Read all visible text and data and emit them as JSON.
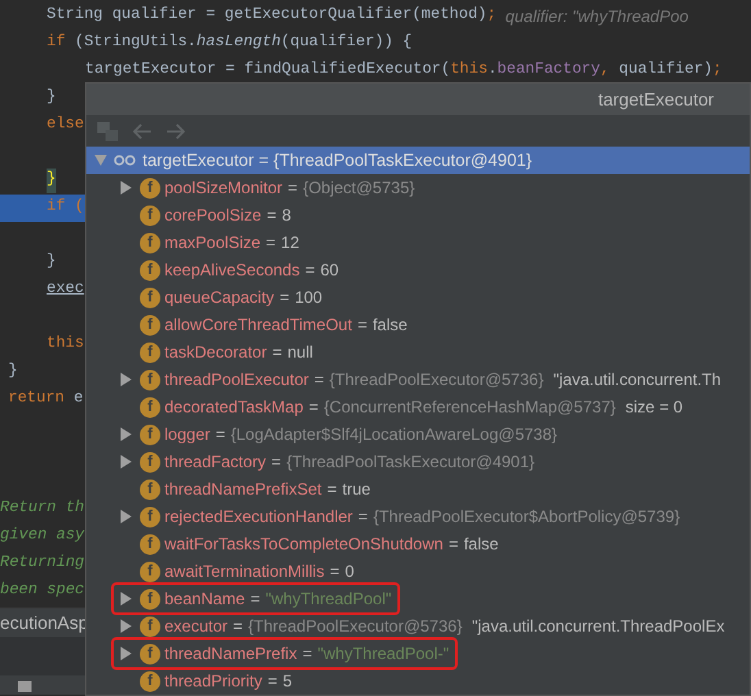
{
  "editor": {
    "lines": [
      {
        "kind": "method",
        "segments": [
          {
            "text": "String qualifier = getExecutorQualifier(method)",
            "kind": "plain"
          },
          {
            "text": ";",
            "kind": "keyword"
          },
          {
            "text": "  qualifier: \"whyThreadPoo",
            "kind": "hint"
          }
        ]
      },
      {
        "kind": "method",
        "segments": [
          {
            "text": "if ",
            "kind": "keyword"
          },
          {
            "text": "(StringUtils.",
            "kind": "plain"
          },
          {
            "text": "hasLength",
            "kind": "italic"
          },
          {
            "text": "(qualifier)) {",
            "kind": "plain"
          }
        ]
      },
      {
        "kind": "block",
        "segments": [
          {
            "text": "targetExecutor = findQualifiedExecutor(",
            "kind": "plain"
          },
          {
            "text": "this",
            "kind": "keyword"
          },
          {
            "text": ".",
            "kind": "plain"
          },
          {
            "text": "beanFactory",
            "kind": "field"
          },
          {
            "text": ", ",
            "kind": "keyword"
          },
          {
            "text": "qualifier)",
            "kind": "plain"
          },
          {
            "text": ";",
            "kind": "keyword"
          }
        ]
      },
      {
        "kind": "method",
        "segments": [
          {
            "text": "}",
            "kind": "plain"
          }
        ]
      },
      {
        "kind": "method",
        "segments": [
          {
            "text": "else",
            "kind": "keyword"
          }
        ]
      },
      {
        "kind": "blank"
      },
      {
        "kind": "method",
        "segments": [
          {
            "text": "}",
            "kind": "brace_match"
          }
        ]
      },
      {
        "kind": "method",
        "current": true,
        "segments": [
          {
            "text": "if (",
            "kind": "keyword"
          }
        ]
      },
      {
        "kind": "blank"
      },
      {
        "kind": "method",
        "segments": [
          {
            "text": "}",
            "kind": "plain"
          }
        ]
      },
      {
        "kind": "method",
        "segments": [
          {
            "text": "exec",
            "kind": "underlined"
          }
        ]
      },
      {
        "kind": "blank"
      },
      {
        "kind": "method",
        "segments": [
          {
            "text": "this",
            "kind": "keyword"
          }
        ]
      },
      {
        "kind": "member",
        "segments": [
          {
            "text": "}",
            "kind": "plain"
          }
        ]
      },
      {
        "kind": "member",
        "segments": [
          {
            "text": "return ",
            "kind": "keyword"
          },
          {
            "text": "e",
            "kind": "plain"
          }
        ]
      },
      {
        "kind": "blank"
      },
      {
        "kind": "blank"
      },
      {
        "kind": "blank"
      },
      {
        "kind": "edge",
        "segments": [
          {
            "text": "Return th",
            "kind": "comment"
          }
        ]
      },
      {
        "kind": "edge",
        "segments": [
          {
            "text": "given asy",
            "kind": "comment"
          }
        ]
      },
      {
        "kind": "edge",
        "segments": [
          {
            "text": "Returning",
            "kind": "comment"
          }
        ]
      },
      {
        "kind": "edge",
        "segments": [
          {
            "text": "been spec",
            "kind": "comment"
          }
        ]
      }
    ],
    "tab": "ecutionAsp"
  },
  "popup": {
    "title": "targetExecutor",
    "tree": [
      {
        "label": "targetExecutor = {ThreadPoolTaskExecutor@4901}",
        "expanded": true,
        "selected": true,
        "children": [
          {
            "badge": "f",
            "name": "poolSizeMonitor",
            "sep": "=",
            "value": "{Object@5735}",
            "kind": "ref",
            "expandable": true,
            "outlined": false
          },
          {
            "badge": "f",
            "name": "corePoolSize",
            "sep": "=",
            "value": "8",
            "kind": "plain",
            "expandable": false,
            "outlined": false
          },
          {
            "badge": "f",
            "name": "maxPoolSize",
            "sep": "=",
            "value": "12",
            "kind": "plain",
            "expandable": false,
            "outlined": false
          },
          {
            "badge": "f",
            "name": "keepAliveSeconds",
            "sep": "=",
            "value": "60",
            "kind": "plain",
            "expandable": false,
            "outlined": false
          },
          {
            "badge": "f",
            "name": "queueCapacity",
            "sep": "=",
            "value": "100",
            "kind": "plain",
            "expandable": false,
            "outlined": false
          },
          {
            "badge": "f",
            "name": "allowCoreThreadTimeOut",
            "sep": "=",
            "value": "false",
            "kind": "plain",
            "expandable": false,
            "outlined": false
          },
          {
            "badge": "f",
            "name": "taskDecorator",
            "sep": "=",
            "value": "null",
            "kind": "plain",
            "expandable": false,
            "outlined": false
          },
          {
            "badge": "f",
            "name": "threadPoolExecutor",
            "sep": "=",
            "value": "{ThreadPoolExecutor@5736}",
            "kind": "ref",
            "extra": "\"java.util.concurrent.Th",
            "expandable": true,
            "outlined": false
          },
          {
            "badge": "f",
            "name": "decoratedTaskMap",
            "sep": "=",
            "value": "{ConcurrentReferenceHashMap@5737}",
            "kind": "ref",
            "extra": "size = 0",
            "expandable": false,
            "outlined": false
          },
          {
            "badge": "f",
            "name": "logger",
            "sep": "=",
            "value": "{LogAdapter$Slf4jLocationAwareLog@5738}",
            "kind": "ref",
            "expandable": true,
            "outlined": false
          },
          {
            "badge": "f",
            "name": "threadFactory",
            "sep": "=",
            "value": "{ThreadPoolTaskExecutor@4901}",
            "kind": "ref",
            "expandable": true,
            "outlined": false
          },
          {
            "badge": "f",
            "name": "threadNamePrefixSet",
            "sep": "=",
            "value": "true",
            "kind": "plain",
            "expandable": false,
            "outlined": false
          },
          {
            "badge": "f",
            "name": "rejectedExecutionHandler",
            "sep": "=",
            "value": "{ThreadPoolExecutor$AbortPolicy@5739}",
            "kind": "ref",
            "expandable": true,
            "outlined": false
          },
          {
            "badge": "f",
            "name": "waitForTasksToCompleteOnShutdown",
            "sep": "=",
            "value": "false",
            "kind": "plain",
            "expandable": false,
            "outlined": false
          },
          {
            "badge": "f",
            "name": "awaitTerminationMillis",
            "sep": "=",
            "value": "0",
            "kind": "plain",
            "expandable": false,
            "outlined": false
          },
          {
            "badge": "f",
            "name": "beanName",
            "sep": "=",
            "value": "\"whyThreadPool\"",
            "kind": "string",
            "expandable": true,
            "outlined": true
          },
          {
            "badge": "f",
            "name": "executor",
            "sep": "=",
            "value": "{ThreadPoolExecutor@5736}",
            "kind": "ref",
            "extra": "\"java.util.concurrent.ThreadPoolEx",
            "expandable": true,
            "outlined": false
          },
          {
            "badge": "f",
            "name": "threadNamePrefix",
            "sep": "=",
            "value": "\"whyThreadPool-\"",
            "kind": "string",
            "expandable": true,
            "outlined": true
          },
          {
            "badge": "f",
            "name": "threadPriority",
            "sep": "=",
            "value": "5",
            "kind": "plain",
            "expandable": false,
            "outlined": false
          }
        ]
      }
    ]
  }
}
